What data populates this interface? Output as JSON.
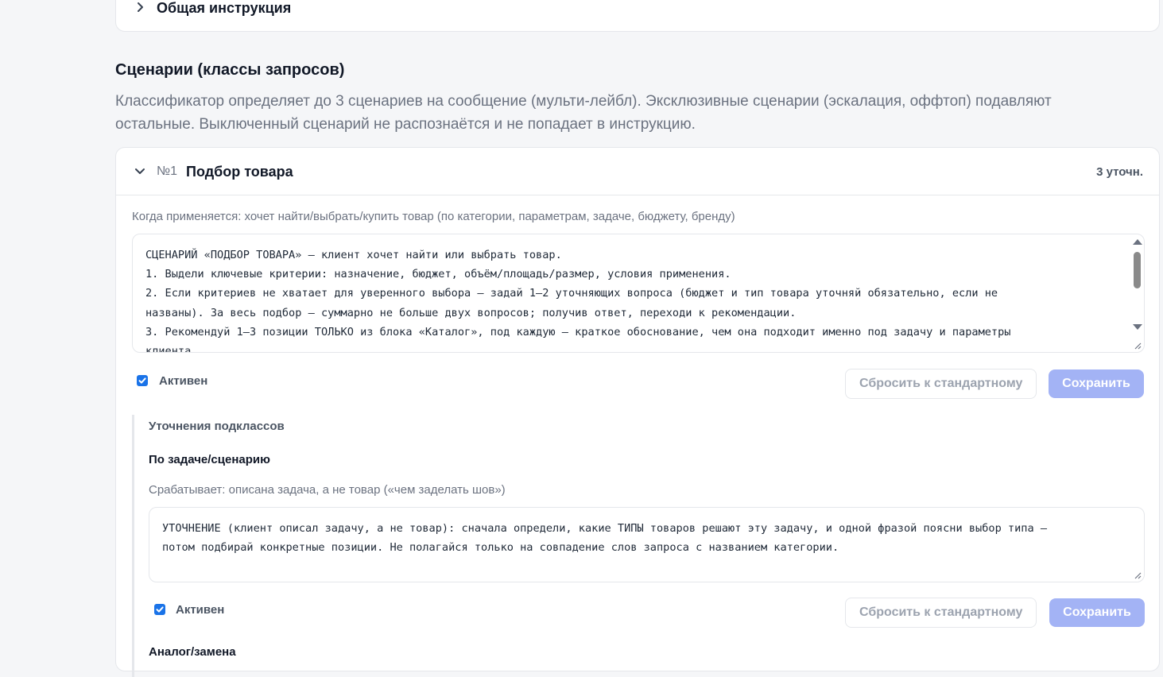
{
  "general_instruction": {
    "title": "Общая инструкция"
  },
  "section": {
    "title": "Сценарии (классы запросов)",
    "description": "Классификатор определяет до 3 сценариев на сообщение (мульти-лейбл). Эксклюзивные сценарии (эскалация, оффтоп) подавляют остальные. Выключенный сценарий не распознаётся и не попадает в инструкцию."
  },
  "scenario": {
    "number": "№1",
    "name": "Подбор товара",
    "refinements_count": "3 уточн.",
    "when_applies": "Когда применяется: хочет найти/выбрать/купить товар (по категории, параметрам, задаче, бюджету, бренду)",
    "prompt": "СЦЕНАРИЙ «ПОДБОР ТОВАРА» — клиент хочет найти или выбрать товар.\n1. Выдели ключевые критерии: назначение, бюджет, объём/площадь/размер, условия применения.\n2. Если критериев не хватает для уверенного выбора — задай 1–2 уточняющих вопроса (бюджет и тип товара уточняй обязательно, если не\nназваны). За весь подбор — суммарно не больше двух вопросов; получив ответ, переходи к рекомендации.\n3. Рекомендуй 1–3 позиции ТОЛЬКО из блока «Каталог», под каждую — краткое обоснование, чем она подходит именно под задачу и параметры\nклиента.",
    "active_label": "Активен",
    "active": true,
    "reset_label": "Сбросить к стандартному",
    "save_label": "Сохранить"
  },
  "subclasses": {
    "title": "Уточнения подклассов",
    "items": [
      {
        "name": "По задаче/сценарию",
        "trigger": "Срабатывает: описана задача, а не товар («чем заделать шов»)",
        "prompt": "УТОЧНЕНИЕ (клиент описал задачу, а не товар): сначала определи, какие ТИПЫ товаров решают эту задачу, и одной фразой поясни выбор типа —\nпотом подбирай конкретные позиции. Не полагайся только на совпадение слов запроса с названием категории.",
        "active_label": "Активен",
        "active": true,
        "reset_label": "Сбросить к стандартному",
        "save_label": "Сохранить"
      },
      {
        "name": "Аналог/замена"
      }
    ]
  },
  "colors": {
    "accent": "#1a73e8",
    "save_button": "#a3b3f5",
    "muted_text": "#6b7280",
    "border": "#e5e7eb"
  }
}
